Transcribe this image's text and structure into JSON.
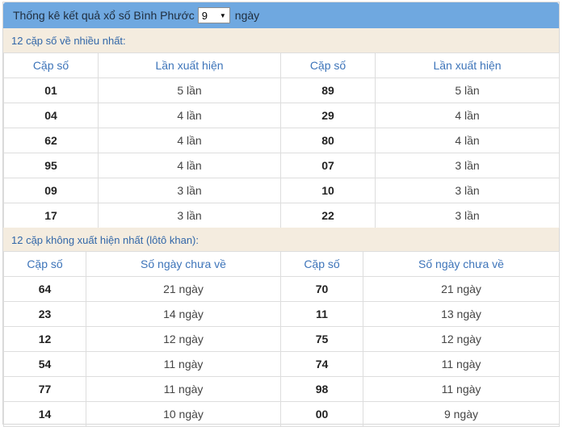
{
  "header": {
    "title": "Thống kê kết quả xổ số Bình Phước",
    "select_value": "9",
    "suffix": "ngày"
  },
  "section1": {
    "title": "12 cặp số về nhiều nhất:",
    "columns": [
      "Cặp số",
      "Lần xuất hiện",
      "Cặp số",
      "Lần xuất hiện"
    ],
    "rows": [
      [
        "01",
        "5 lần",
        "89",
        "5 lần"
      ],
      [
        "04",
        "4 lần",
        "29",
        "4 lần"
      ],
      [
        "62",
        "4 lần",
        "80",
        "4 lần"
      ],
      [
        "95",
        "4 lần",
        "07",
        "3 lần"
      ],
      [
        "09",
        "3 lần",
        "10",
        "3 lần"
      ],
      [
        "17",
        "3 lần",
        "22",
        "3 lần"
      ]
    ]
  },
  "section2": {
    "title": "12 cặp không xuất hiện nhất (lôtô khan):",
    "columns": [
      "Cặp số",
      "Số ngày chưa về",
      "Cặp số",
      "Số ngày chưa về"
    ],
    "rows": [
      [
        "64",
        "21 ngày",
        "70",
        "21 ngày"
      ],
      [
        "23",
        "14 ngày",
        "11",
        "13 ngày"
      ],
      [
        "12",
        "12 ngày",
        "75",
        "12 ngày"
      ],
      [
        "54",
        "11 ngày",
        "74",
        "11 ngày"
      ],
      [
        "77",
        "11 ngày",
        "98",
        "11 ngày"
      ],
      [
        "14",
        "10 ngày",
        "00",
        "9 ngày"
      ]
    ]
  }
}
